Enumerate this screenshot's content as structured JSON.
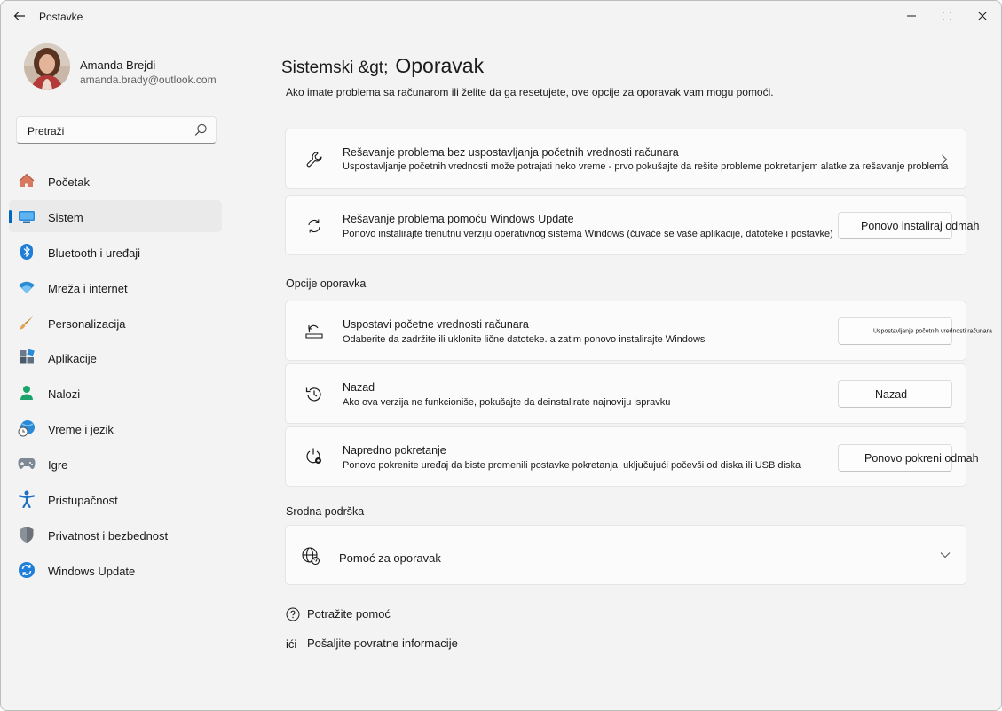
{
  "window": {
    "title": "Postavke"
  },
  "profile": {
    "name": "Amanda Brejdi",
    "email": "amanda.brady@outlook.com"
  },
  "search": {
    "placeholder": "Pretraži"
  },
  "sidebar": {
    "items": [
      {
        "label": "Početak",
        "icon": "home-icon",
        "active": false
      },
      {
        "label": "Sistem",
        "icon": "system-icon",
        "active": true
      },
      {
        "label": "Bluetooth i uređaji",
        "icon": "bluetooth-icon",
        "active": false
      },
      {
        "label": "Mreža i internet",
        "icon": "wifi-icon",
        "active": false
      },
      {
        "label": "Personalizacija",
        "icon": "brush-icon",
        "active": false
      },
      {
        "label": "Aplikacije",
        "icon": "apps-icon",
        "active": false
      },
      {
        "label": "Nalozi",
        "icon": "person-icon",
        "active": false
      },
      {
        "label": "Vreme i jezik",
        "icon": "globe-clock-icon",
        "active": false
      },
      {
        "label": "Igre",
        "icon": "gamepad-icon",
        "active": false
      },
      {
        "label": "Pristupačnost",
        "icon": "accessibility-icon",
        "active": false
      },
      {
        "label": "Privatnost i bezbednost",
        "icon": "shield-icon",
        "active": false
      },
      {
        "label": "Windows Update",
        "icon": "update-icon",
        "active": false
      }
    ]
  },
  "main": {
    "breadcrumb_parent": "Sistemski &gt;",
    "breadcrumb_current": "Oporavak",
    "subtitle": "Ako imate problema sa računarom ili želite da ga resetujete, ove opcije za oporavak vam mogu pomoći.",
    "troubleshoot": {
      "title": "Rešavanje problema bez uspostavljanja početnih vrednosti računara",
      "description": "Uspostavljanje početnih vrednosti može potrajati neko vreme - prvo pokušajte da rešite probleme pokretanjem alatke za rešavanje problema"
    },
    "windows_update_fix": {
      "title": "Rešavanje problema pomoću Windows Update",
      "description": "Ponovo instalirajte trenutnu verziju operativnog sistema Windows (čuvaće se vaše aplikacije, datoteke i postavke)",
      "button": "Ponovo instaliraj odmah"
    },
    "options_label": "Opcije oporavka",
    "reset": {
      "title": "Uspostavi početne vrednosti računara",
      "description": "Odaberite da zadržite ili uklonite lične datoteke. a zatim ponovo instalirajte Windows",
      "button": "Uspostavljanje početnih vrednosti računara"
    },
    "goback": {
      "title": "Nazad",
      "description": "Ako ova verzija ne funkcioniše, pokušajte da deinstalirate najnoviju ispravku",
      "button": "Nazad"
    },
    "advanced": {
      "title": "Napredno pokretanje",
      "description": "Ponovo pokrenite uređaj da biste promenili postavke pokretanja. uključujući počevši od diska ili USB diska",
      "button": "Ponovo pokreni odmah"
    },
    "related_label": "Srodna podrška",
    "help": {
      "title": "Pomoć za oporavak"
    },
    "footer": {
      "get_help": "Potražite pomoć",
      "feedback_glyph": "ići",
      "feedback": "Pošaljite povratne informacije"
    }
  },
  "colors": {
    "accent": "#0067c0",
    "window_bg": "#f3f3f3",
    "card_bg": "#fbfbfb"
  }
}
